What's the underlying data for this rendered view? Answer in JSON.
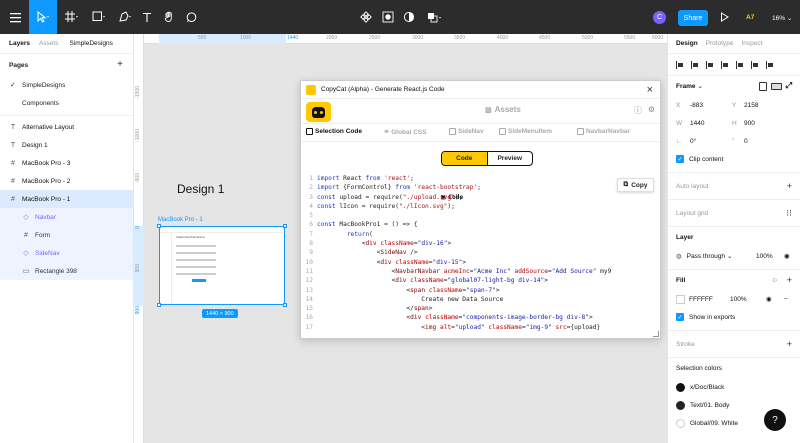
{
  "toolbar": {
    "avatar_initial": "C",
    "share_label": "Share",
    "play_icon": "play-icon",
    "user_count": "A7",
    "zoom": "16%"
  },
  "left_panel": {
    "tabs": [
      "Layers",
      "Assets"
    ],
    "file_name": "SimpleDesigns",
    "pages_heading": "Pages",
    "pages": [
      {
        "label": "SimpleDesigns",
        "current": true
      },
      {
        "label": "Components",
        "current": false
      }
    ],
    "layers": [
      {
        "label": "Alternative Layout",
        "icon": "text"
      },
      {
        "label": "Design 1",
        "icon": "text"
      },
      {
        "label": "MacBook Pro - 3",
        "icon": "frame"
      },
      {
        "label": "MacBook Pro - 2",
        "icon": "frame"
      },
      {
        "label": "MacBook Pro - 1",
        "icon": "frame"
      },
      {
        "label": "Navbar",
        "icon": "component"
      },
      {
        "label": "Form",
        "icon": "frame"
      },
      {
        "label": "SideNav",
        "icon": "component"
      },
      {
        "label": "Rectangle 398",
        "icon": "rectangle"
      }
    ]
  },
  "canvas": {
    "ruler_top": [
      "500",
      "1000",
      "1440",
      "2000",
      "2500",
      "3000",
      "3500",
      "4000",
      "4500",
      "5000",
      "5500",
      "6000",
      "6500"
    ],
    "ruler_left": [
      "-1500",
      "-1000",
      "-500",
      "0",
      "500",
      "900"
    ],
    "design_title": "Design 1",
    "frame_label": "MacBook Pro - 1",
    "frame_size": "1440 × 900",
    "mini_heading": "Create New Data Source"
  },
  "dialog": {
    "title": "CopyCat (Alpha) - Generate React.js Code",
    "tabs": [
      "Code",
      "Assets"
    ],
    "subtabs": [
      "Selection Code",
      "Global CSS",
      "SideNav",
      "SideMenuItem",
      "NavbarNavbar"
    ],
    "subtab_prefix": "</>",
    "toggle": [
      "Code",
      "Preview"
    ],
    "copy_label": "Copy"
  },
  "right_panel": {
    "tabs": [
      "Design",
      "Prototype",
      "Inspect"
    ],
    "frame_heading": "Frame",
    "x_label": "X",
    "x": "-883",
    "y_label": "Y",
    "y": "2158",
    "w_label": "W",
    "w": "1440",
    "h_label": "H",
    "h": "900",
    "rotation": "0°",
    "radius": "0",
    "clip_content": "Clip content",
    "auto_layout": "Auto layout",
    "layout_grid": "Layout grid",
    "layer_heading": "Layer",
    "blend": "Pass through",
    "layer_opacity": "100%",
    "fill_heading": "Fill",
    "fill_hex": "FFFFFF",
    "fill_opacity": "100%",
    "show_exports": "Show in exports",
    "stroke": "Stroke",
    "selection_colors": "Selection colors",
    "colors": [
      {
        "name": "x/Doc/Black",
        "hex": "#111111"
      },
      {
        "name": "Text/01. Body",
        "hex": "#222222"
      },
      {
        "name": "Global/09. White",
        "hex": "#ffffff"
      }
    ],
    "help": "?"
  },
  "code_lines": [
    {
      "n": "1",
      "parts": [
        [
          "kw",
          "import"
        ],
        [
          "tx",
          " React "
        ],
        [
          "kw",
          "from"
        ],
        [
          "tx",
          " "
        ],
        [
          "str",
          "'react'"
        ],
        [
          "tx",
          ";"
        ]
      ]
    },
    {
      "n": "2",
      "parts": [
        [
          "kw",
          "import"
        ],
        [
          "tx",
          " {FormControl} "
        ],
        [
          "kw",
          "from"
        ],
        [
          "tx",
          " "
        ],
        [
          "str",
          "'react-bootstrap'"
        ],
        [
          "tx",
          ";"
        ]
      ]
    },
    {
      "n": "3",
      "parts": [
        [
          "kw",
          "const"
        ],
        [
          "tx",
          " upload = require("
        ],
        [
          "str",
          "\"./upload.svg\""
        ],
        [
          "tx",
          ");"
        ]
      ]
    },
    {
      "n": "4",
      "parts": [
        [
          "kw",
          "const"
        ],
        [
          "tx",
          " lIcon = require("
        ],
        [
          "str",
          "\"./lIcon.svg\""
        ],
        [
          "tx",
          ");"
        ]
      ]
    },
    {
      "n": "5",
      "parts": [
        [
          "tx",
          ""
        ]
      ]
    },
    {
      "n": "6",
      "parts": [
        [
          "kw",
          "const"
        ],
        [
          "tx",
          " MacBookPro1 = () => {"
        ]
      ]
    },
    {
      "n": "7",
      "parts": [
        [
          "tx",
          "        "
        ],
        [
          "kw",
          "return"
        ],
        [
          "tx",
          "("
        ]
      ]
    },
    {
      "n": "8",
      "parts": [
        [
          "tx",
          "            <"
        ],
        [
          "tag",
          "div"
        ],
        [
          "tx",
          " "
        ],
        [
          "attr",
          "className"
        ],
        [
          "tx",
          "="
        ],
        [
          "val",
          "\"div-16\""
        ],
        [
          "tx",
          ">"
        ]
      ]
    },
    {
      "n": "9",
      "parts": [
        [
          "tx",
          "                <"
        ],
        [
          "tag",
          "SideNav"
        ],
        [
          "tx",
          " />"
        ]
      ]
    },
    {
      "n": "10",
      "parts": [
        [
          "tx",
          "                <"
        ],
        [
          "tag",
          "div"
        ],
        [
          "tx",
          " "
        ],
        [
          "attr",
          "className"
        ],
        [
          "tx",
          "="
        ],
        [
          "val",
          "\"div-15\""
        ],
        [
          "tx",
          ">"
        ]
      ]
    },
    {
      "n": "11",
      "parts": [
        [
          "tx",
          "                    <"
        ],
        [
          "tag",
          "NavbarNavbar"
        ],
        [
          "tx",
          " "
        ],
        [
          "attr",
          "acmeInc"
        ],
        [
          "tx",
          "="
        ],
        [
          "val",
          "\"Acme Inc\""
        ],
        [
          "tx",
          " "
        ],
        [
          "attr",
          "addSource"
        ],
        [
          "tx",
          "="
        ],
        [
          "val",
          "\"Add Source\""
        ],
        [
          "tx",
          " my9"
        ]
      ]
    },
    {
      "n": "12",
      "parts": [
        [
          "tx",
          "                    <"
        ],
        [
          "tag",
          "div"
        ],
        [
          "tx",
          " "
        ],
        [
          "attr",
          "className"
        ],
        [
          "tx",
          "="
        ],
        [
          "val",
          "\"global07-light-bg div-14\""
        ],
        [
          "tx",
          ">"
        ]
      ]
    },
    {
      "n": "13",
      "parts": [
        [
          "tx",
          "                        <"
        ],
        [
          "tag",
          "span"
        ],
        [
          "tx",
          " "
        ],
        [
          "attr",
          "className"
        ],
        [
          "tx",
          "="
        ],
        [
          "val",
          "\"span-7\""
        ],
        [
          "tx",
          ">"
        ]
      ]
    },
    {
      "n": "14",
      "parts": [
        [
          "tx",
          "                            Create new Data Source"
        ]
      ]
    },
    {
      "n": "15",
      "parts": [
        [
          "tx",
          "                        </"
        ],
        [
          "tag",
          "span"
        ],
        [
          "tx",
          ">"
        ]
      ]
    },
    {
      "n": "16",
      "parts": [
        [
          "tx",
          "                        <"
        ],
        [
          "tag",
          "div"
        ],
        [
          "tx",
          " "
        ],
        [
          "attr",
          "className"
        ],
        [
          "tx",
          "="
        ],
        [
          "val",
          "\"components-image-border-bg div-8\""
        ],
        [
          "tx",
          ">"
        ]
      ]
    },
    {
      "n": "17",
      "parts": [
        [
          "tx",
          "                            <"
        ],
        [
          "tag",
          "img"
        ],
        [
          "tx",
          " "
        ],
        [
          "attr",
          "alt"
        ],
        [
          "tx",
          "="
        ],
        [
          "val",
          "\"upload\""
        ],
        [
          "tx",
          " "
        ],
        [
          "attr",
          "className"
        ],
        [
          "tx",
          "="
        ],
        [
          "val",
          "\"img-9\""
        ],
        [
          "tx",
          " "
        ],
        [
          "attr",
          "src"
        ],
        [
          "tx",
          "={upload}"
        ]
      ]
    }
  ]
}
